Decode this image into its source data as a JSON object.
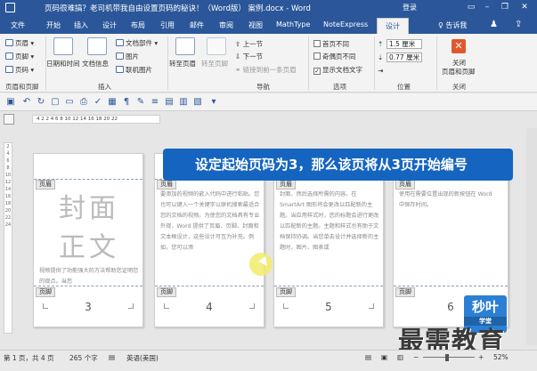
{
  "window": {
    "title": "页码很难搞？老司机带我自由设置页码的秘诀！（Word版） 案例.docx - Word",
    "login_label": "登录",
    "minimize_icon": "minimize-icon",
    "restore_icon": "restore-icon",
    "close_icon": "close-icon"
  },
  "tabs": {
    "items": [
      "文件",
      "开始",
      "插入",
      "设计",
      "布局",
      "引用",
      "邮件",
      "审阅",
      "视图",
      "MathType",
      "NoteExpress"
    ],
    "active": "设计",
    "tell_me": "告诉我",
    "user_icon": "user-icon",
    "share_icon": "share-icon"
  },
  "ribbon": {
    "header_footer": {
      "header": "页眉",
      "footer": "页脚",
      "page_number": "页码",
      "label": "页眉和页脚"
    },
    "insert": {
      "date_time": "日期和时间",
      "doc_info": "文档信息",
      "doc_parts": "文档部件",
      "picture": "图片",
      "online_picture": "联机图片",
      "label": "插入"
    },
    "navigation": {
      "goto_header": "转至页眉",
      "goto_footer": "转至页脚",
      "previous": "上一节",
      "next": "下一节",
      "link_previous": "链接到前一条页眉",
      "label": "导航"
    },
    "options": {
      "different_first_page": "首页不同",
      "different_odd_even": "奇偶页不同",
      "show_document_text": "显示文档文字",
      "show_document_text_checked": true,
      "label": "选项"
    },
    "position": {
      "header_top": "1.5 厘米",
      "footer_bottom": "0.77 厘米",
      "label": "位置"
    },
    "close": {
      "label1": "关闭",
      "label2": "页眉和页脚",
      "group": "关闭"
    }
  },
  "ruler": {
    "scale": "4 2  2 4 6 8 10 12 14 16 18 20 22"
  },
  "banner": {
    "text": "设定起始页码为3，那么该页将从3页开始编号"
  },
  "pages": [
    {
      "header_tag": "页眉",
      "footer_tag": "页脚",
      "big_line1": "封面",
      "big_line2": "正文",
      "body": "视频提供了功能强大的方法帮助您证明您的观点。当您",
      "number": "3"
    },
    {
      "header_tag": "页眉",
      "footer_tag": "页脚",
      "body": "要添加的视频的嵌入代码中进行粘贴。您也可以键入一个关键字以联机搜索最适合您的文档的视频。为使您的文档具有专业外观，Word 提供了页眉、页脚、封面和文本框设计，这些设计可互为补充。例如，您可以添",
      "number": "4"
    },
    {
      "header_tag": "页眉",
      "footer_tag": "页脚",
      "body": "封面、然后选择所需的内容。在 SmartArt 图形将会更改以匹配新的主题。当应用样式时，您的标题会进行更改以匹配新的主题。主题和样式也有助于文档保持协调。当您单击设计并选择新的主题时，图片、图表或",
      "number": "5"
    },
    {
      "header_tag": "页眉",
      "footer_tag": "页脚",
      "body": "使用在需要位置出现的新按钮在 Word 中保存时间。",
      "number": "6"
    }
  ],
  "status": {
    "page": "第 1 页，共 4 页",
    "words": "265 个字",
    "language": "英语(美国)",
    "zoom": "52%"
  },
  "watermark": {
    "logo_top": "秒叶",
    "logo_bottom": "学堂",
    "text": "最需教育"
  },
  "colors": {
    "title_bar": "#2b579a",
    "banner": "#1565c0",
    "cursor_highlight": "#f2ea6a",
    "close_button": "#e0572e"
  }
}
